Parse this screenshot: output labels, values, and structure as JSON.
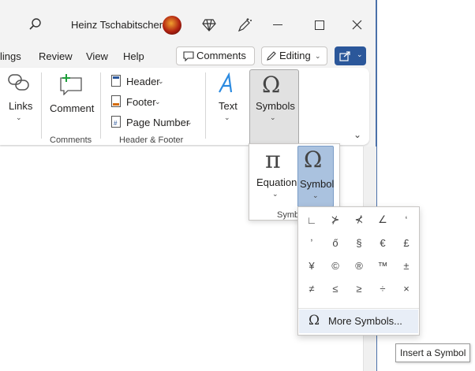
{
  "titlebar": {
    "user_name": "Heinz Tschabitscher"
  },
  "menu": {
    "items": [
      "lings",
      "Review",
      "View",
      "Help"
    ]
  },
  "header_buttons": {
    "comments": "Comments",
    "editing": "Editing"
  },
  "ribbon": {
    "links": "Links",
    "comment": "Comment",
    "comments_group": "Comments",
    "header": "Header",
    "footer": "Footer",
    "page_number": "Page Number",
    "header_footer_group": "Header & Footer",
    "text": "Text",
    "symbols": "Symbols"
  },
  "symbols_popup": {
    "equation": "Equation",
    "symbol": "Symbol",
    "group_label": "Symb"
  },
  "symbol_gallery": {
    "rows": [
      [
        "∟",
        "⊁",
        "⊀",
        "∠",
        "ʻ"
      ],
      [
        "ʼ",
        "ő",
        "§",
        "€",
        "£"
      ],
      [
        "¥",
        "©",
        "®",
        "™",
        "±"
      ],
      [
        "≠",
        "≤",
        "≥",
        "÷",
        "×"
      ]
    ],
    "more_symbols": "More Symbols..."
  },
  "tooltip": "Insert a Symbol",
  "colors": {
    "accent": "#2b579a",
    "selected": "#aac2df",
    "pressed": "#e1e1e1"
  }
}
